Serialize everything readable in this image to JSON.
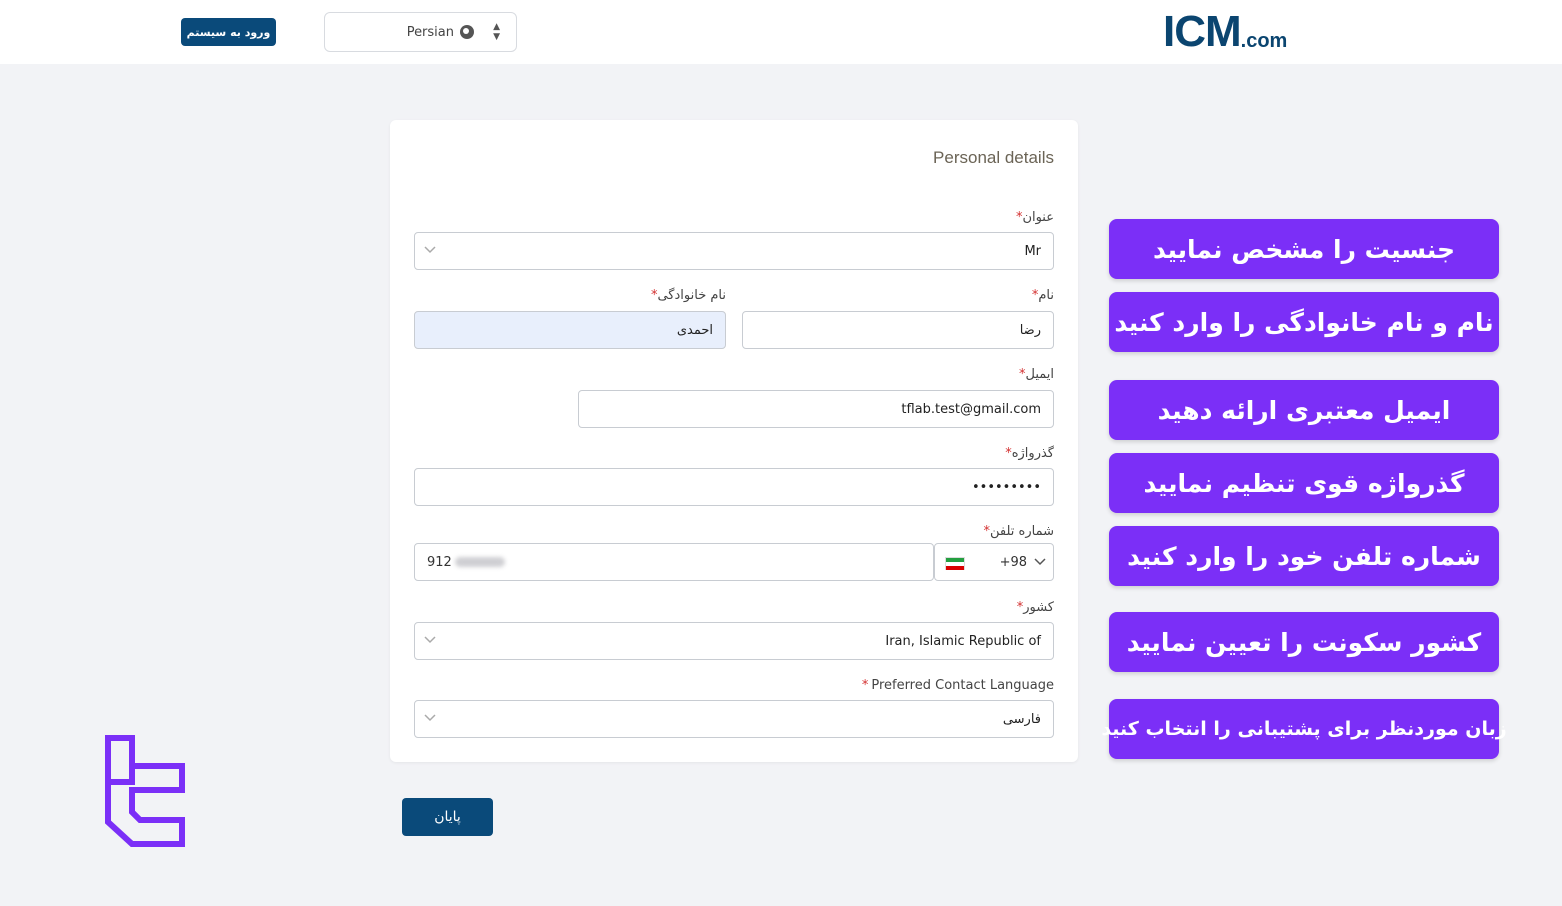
{
  "header": {
    "login_label": "ورود به سیستم",
    "language_label": "Persian",
    "logo_main": "ICM",
    "logo_suffix": ".com"
  },
  "form": {
    "title": "Personal details",
    "fields": {
      "title_label": "عنوان",
      "title_value": "Mr",
      "first_name_label": "نام",
      "first_name_value": "رضا",
      "last_name_label": "نام خانوادگی",
      "last_name_value": "احمدی",
      "email_label": "ایمیل",
      "email_value": "tflab.test@gmail.com",
      "password_label": "گذرواژه",
      "password_value": "•••••••••",
      "phone_label": "شماره تلفن",
      "phone_code": "+98",
      "phone_value_visible": "912",
      "country_label": "کشور",
      "country_value": "Iran, Islamic Republic of",
      "contact_language_label": "Preferred Contact Language",
      "contact_language_value": "فارسی"
    },
    "required_mark": "*",
    "submit_label": "پایان"
  },
  "hints": [
    "جنسیت را مشخص نمایید",
    "نام و نام خانوادگی را وارد کنید",
    "ایمیل معتبری ارائه دهید",
    "گذرواژه قوی تنظیم نمایید",
    "شماره تلفن خود را وارد کنید",
    "کشور سکونت را تعیین نمایید",
    "زبان موردنظر برای پشتیبانی را انتخاب کنید"
  ],
  "icons": {
    "language": "globe-icon",
    "sort": "updown-icon",
    "dropdown": "chevron-down-icon",
    "flag": "iran-flag-icon",
    "brand": "brand-mark-icon"
  },
  "colors": {
    "primary": "#0a4a7a",
    "hint_bg": "#7b2ff7",
    "page_bg": "#f2f3f6",
    "required": "#d32f2f",
    "autofill_bg": "#e8effc"
  }
}
